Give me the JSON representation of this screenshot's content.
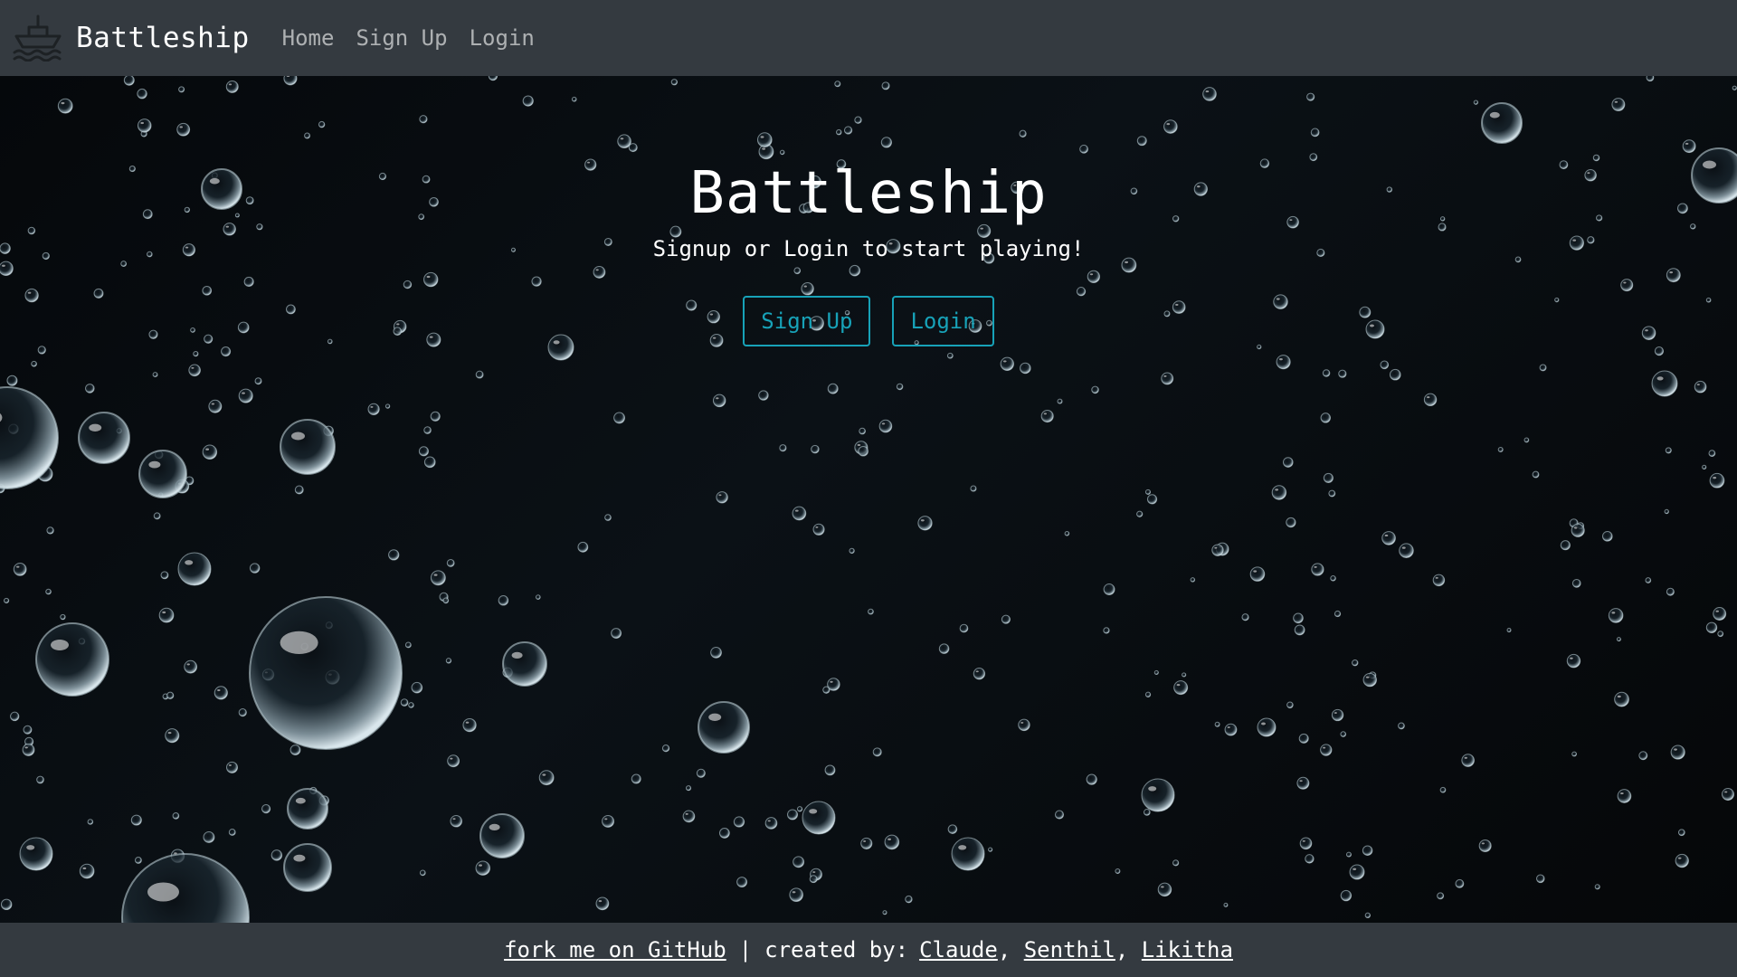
{
  "navbar": {
    "brand_icon": "ship-icon",
    "brand": "Battleship",
    "links": [
      "Home",
      "Sign Up",
      "Login"
    ]
  },
  "hero": {
    "title": "Battleship",
    "subtitle": "Signup or Login to start playing!",
    "signup_button": "Sign Up",
    "login_button": "Login",
    "background": "water-bubbles-image"
  },
  "footer": {
    "github_link": "fork me on GitHub",
    "separator": "|",
    "created_by": "created by:",
    "authors": [
      "Claude",
      "Senthil",
      "Likitha"
    ]
  },
  "colors": {
    "navbar_bg": "#343a40",
    "accent": "#17a2b8",
    "text": "#ffffff"
  }
}
